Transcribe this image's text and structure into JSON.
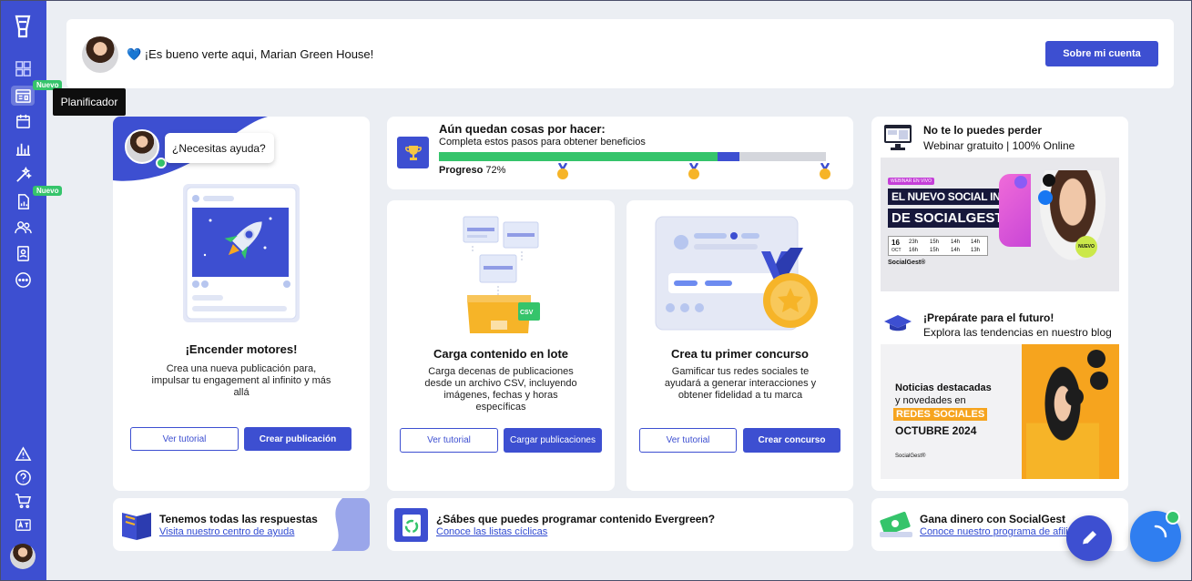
{
  "sidebar": {
    "badges": [
      "Nuevo",
      "Nuevo"
    ],
    "tooltip": "Planificador",
    "icons": [
      "logo-icon",
      "dashboard-icon",
      "planner-icon",
      "calendar-icon",
      "analytics-icon",
      "magic-wand-icon",
      "report-icon",
      "users-icon",
      "contacts-icon",
      "more-icon",
      "alert-icon",
      "help-icon",
      "cart-icon",
      "language-icon",
      "user-avatar"
    ]
  },
  "header": {
    "greeting": "💙 ¡Es bueno verte aqui, Marian Green House!",
    "account_button": "Sobre mi cuenta"
  },
  "help_card": {
    "bubble": "¿Necesitas ayuda?",
    "title": "¡Encender motores!",
    "description": "Crea una nueva publicación para, impulsar tu engagement al infinito y más allá",
    "tutorial_button": "Ver tutorial",
    "action_button": "Crear publicación"
  },
  "progress_card": {
    "title": "Aún quedan cosas por hacer:",
    "subtitle": "Completa estos pasos para obtener beneficios",
    "progress_label": "Progreso",
    "progress_value": "72%",
    "progress_fraction": 0.72,
    "colors": {
      "done": "#35c46b",
      "current": "#3d4fd1",
      "rest": "#d4d6dc"
    }
  },
  "batch_card": {
    "title": "Carga contenido en lote",
    "description": "Carga decenas de publicaciones desde un archivo CSV, incluyendo imágenes, fechas y horas específicas",
    "file_label": "CSV",
    "tutorial_button": "Ver tutorial",
    "action_button": "Cargar publicaciones"
  },
  "contest_card": {
    "title": "Crea tu primer concurso",
    "description": "Gamificar tus redes sociales te ayudará a generar interacciones y obtener fidelidad a tu marca",
    "tutorial_button": "Ver tutorial",
    "action_button": "Crear concurso"
  },
  "webinar": {
    "title": "No te lo puedes perder",
    "subtitle": "Webinar gratuito | 100% Online",
    "tag": "WEBINAR EN VIVO",
    "headline1": "EL NUEVO SOCIAL INBOX",
    "headline2": "DE SOCIALGEST",
    "day": "16",
    "month": "OCT",
    "times": [
      "23h",
      "15h",
      "14h",
      "14h",
      "16h",
      "15h",
      "14h",
      "13h"
    ],
    "brand": "SocialGest®",
    "new_badge": "NUEVO"
  },
  "blog": {
    "title": "¡Prepárate para el futuro!",
    "subtitle": "Explora las tendencias en nuestro blog",
    "line1": "Noticias destacadas",
    "line2": "y novedades en",
    "highlight": "REDES SOCIALES",
    "line3": "OCTUBRE 2024",
    "brand": "SocialGest®"
  },
  "bottom": [
    {
      "title": "Tenemos todas las respuestas",
      "link": "Visita nuestro centro de ayuda"
    },
    {
      "title": "¿Sábes que puedes programar contenido Evergreen?",
      "link": "Conoce las listas cíclicas"
    },
    {
      "title": "Gana dinero con SocialGest",
      "link": "Conoce nuestro programa de afili"
    }
  ],
  "colors": {
    "brand": "#3d4fd1",
    "green": "#35c46b",
    "background": "#ebeef3"
  }
}
